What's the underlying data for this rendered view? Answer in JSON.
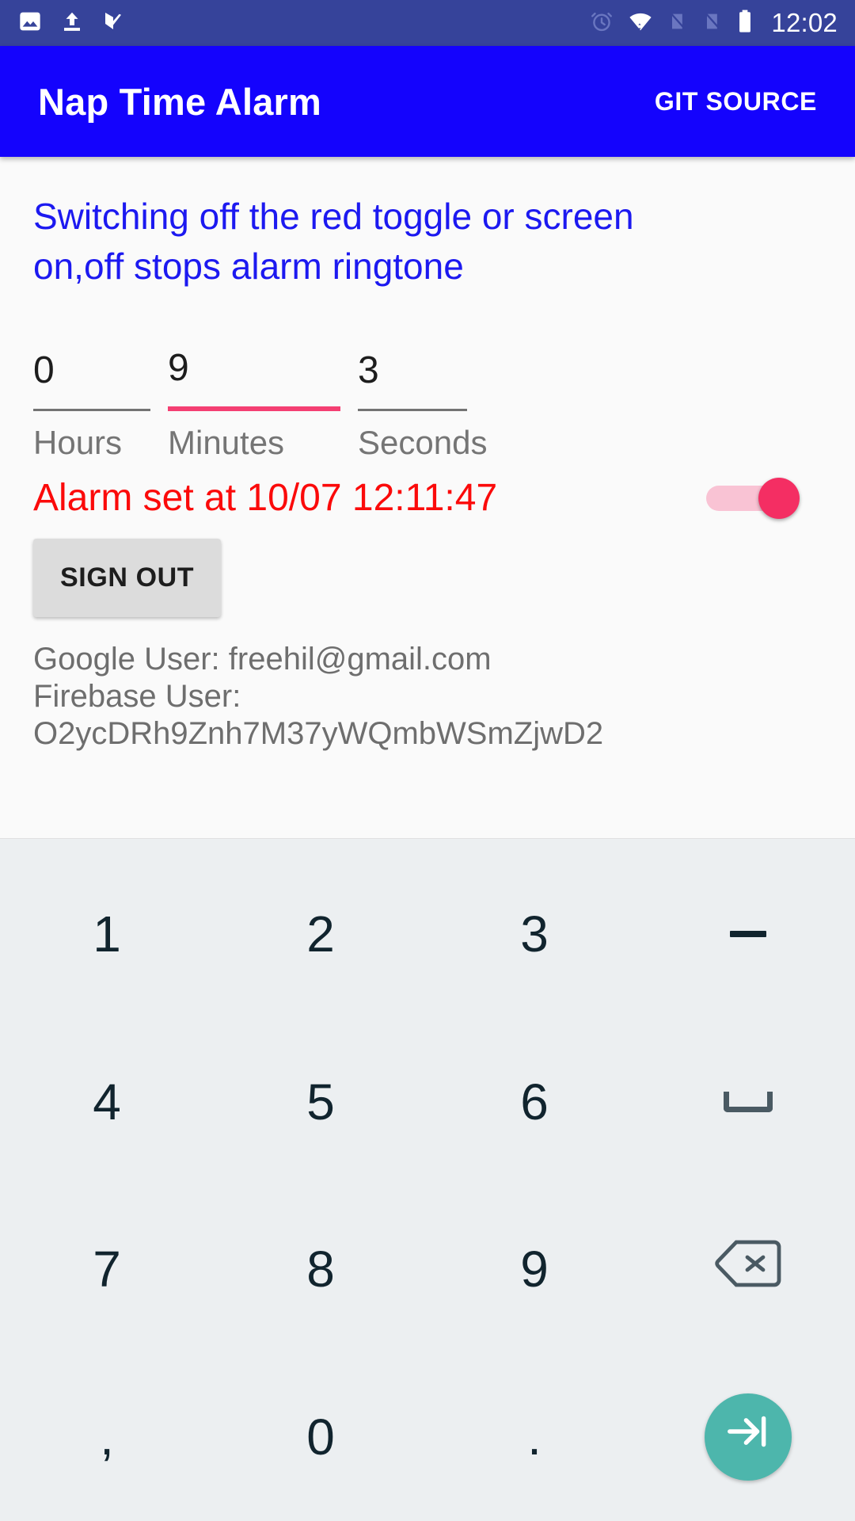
{
  "statusbar": {
    "time": "12:02",
    "left_icons": [
      {
        "name": "image-icon"
      },
      {
        "name": "upload-icon"
      },
      {
        "name": "tasks-checkmark-icon"
      }
    ],
    "right_icons": [
      {
        "name": "alarm-clock-icon"
      },
      {
        "name": "wifi-icon"
      },
      {
        "name": "no-signal-icon"
      },
      {
        "name": "no-sim-icon"
      },
      {
        "name": "battery-icon"
      }
    ],
    "background_color": "#36439a"
  },
  "appbar": {
    "title": "Nap Time Alarm",
    "action_label": "GIT SOURCE",
    "background_color": "#1403fd"
  },
  "main": {
    "instructions": "Switching off the red toggle or screen on,off stops alarm ringtone",
    "instructions_color": "#1c19f0",
    "time_inputs": [
      {
        "value": "0",
        "label": "Hours",
        "focused": false
      },
      {
        "value": "9",
        "label": "Minutes",
        "focused": true
      },
      {
        "value": "3",
        "label": "Seconds",
        "focused": false
      }
    ],
    "alarm_status": "Alarm set at 10/07 12:11:47",
    "alarm_status_color": "#fb0a0a",
    "alarm_toggle": {
      "state": "on",
      "accent_color": "#f42e63",
      "track_color": "#f9c3d4"
    },
    "signout_label": "SIGN OUT",
    "google_user": "Google User: freehil@gmail.com",
    "firebase_user_label": "Firebase User:",
    "firebase_uid": "O2ycDRh9Znh7M37yWQmbWSmZjwD2"
  },
  "keyboard": {
    "background_color": "#eceff1",
    "accent_color": "#4db6ac",
    "rows": [
      [
        {
          "label": "1",
          "name": "key-1",
          "type": "digit"
        },
        {
          "label": "2",
          "name": "key-2",
          "type": "digit"
        },
        {
          "label": "3",
          "name": "key-3",
          "type": "digit"
        },
        {
          "label": "-",
          "name": "key-minus",
          "type": "dash"
        }
      ],
      [
        {
          "label": "4",
          "name": "key-4",
          "type": "digit"
        },
        {
          "label": "5",
          "name": "key-5",
          "type": "digit"
        },
        {
          "label": "6",
          "name": "key-6",
          "type": "digit"
        },
        {
          "label": " ",
          "name": "key-space",
          "type": "space"
        }
      ],
      [
        {
          "label": "7",
          "name": "key-7",
          "type": "digit"
        },
        {
          "label": "8",
          "name": "key-8",
          "type": "digit"
        },
        {
          "label": "9",
          "name": "key-9",
          "type": "digit"
        },
        {
          "label": "",
          "name": "key-backspace",
          "type": "backspace"
        }
      ],
      [
        {
          "label": ",",
          "name": "key-comma",
          "type": "digit"
        },
        {
          "label": "0",
          "name": "key-0",
          "type": "digit"
        },
        {
          "label": ".",
          "name": "key-period",
          "type": "digit"
        },
        {
          "label": "",
          "name": "key-enter",
          "type": "enter"
        }
      ]
    ]
  }
}
